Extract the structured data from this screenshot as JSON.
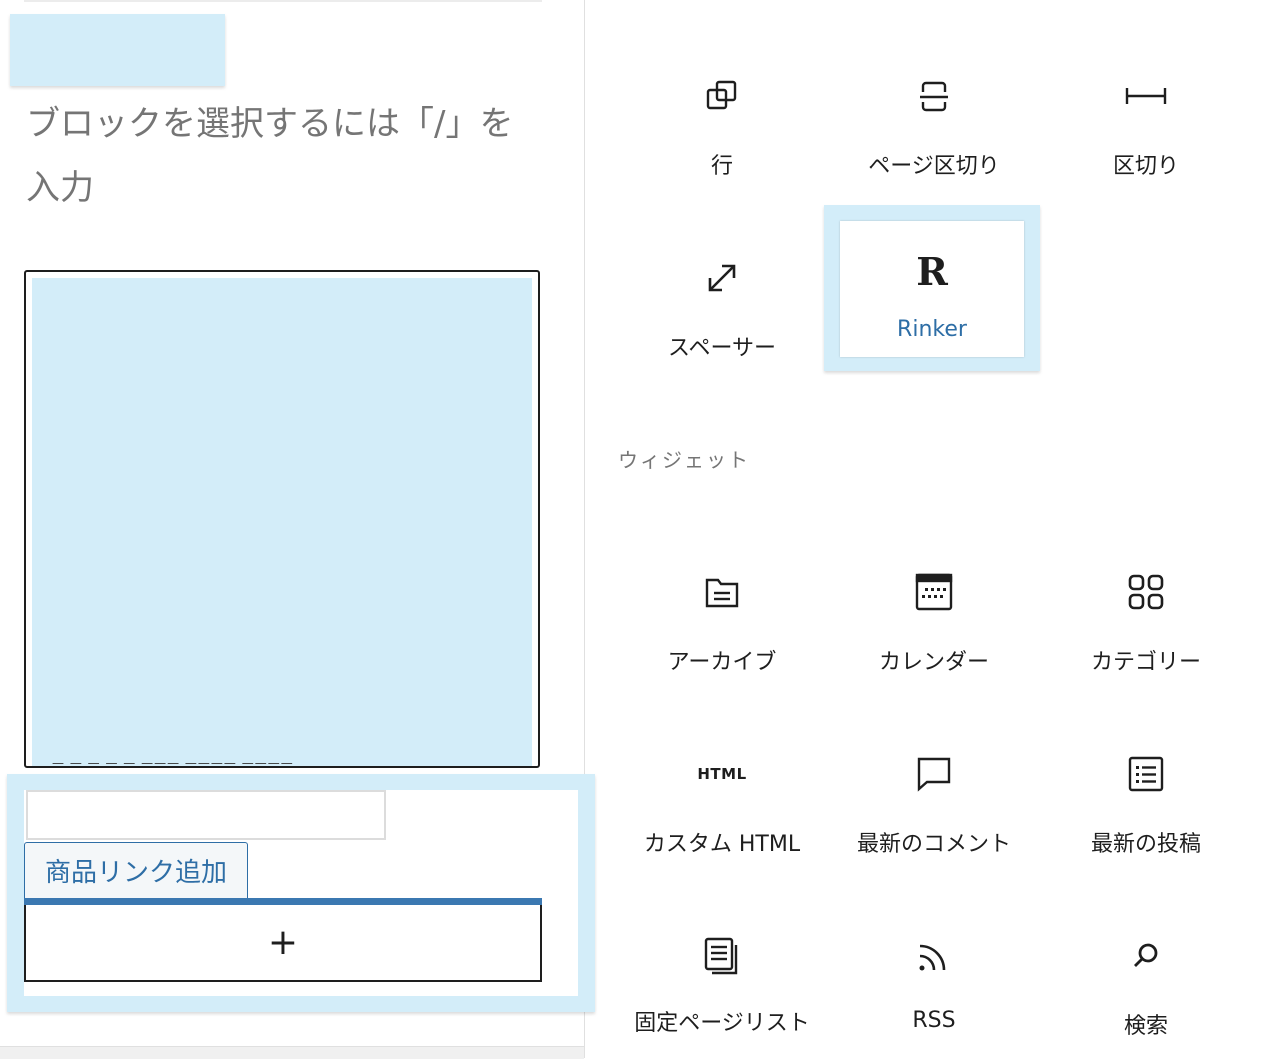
{
  "editor": {
    "placeholder": "ブロックを選択するには「/」を入力",
    "partial_text": "— — — — — ——— ———— ————",
    "rinker": {
      "add_link_tab": "商品リンク追加",
      "appender_glyph": "+"
    }
  },
  "inserter": {
    "design_blocks": [
      {
        "label": "行",
        "icon": "row-icon"
      },
      {
        "label": "ページ区切り",
        "icon": "page-break-icon"
      },
      {
        "label": "区切り",
        "icon": "separator-icon"
      },
      {
        "label": "スペーサー",
        "icon": "spacer-icon"
      }
    ],
    "rinker_block": {
      "label": "Rinker",
      "icon_glyph": "R"
    },
    "widgets_title": "ウィジェット",
    "widget_blocks": [
      {
        "label": "アーカイブ",
        "icon": "archive-icon"
      },
      {
        "label": "カレンダー",
        "icon": "calendar-icon"
      },
      {
        "label": "カテゴリー",
        "icon": "categories-icon"
      },
      {
        "label": "カスタム HTML",
        "icon": "html-icon",
        "icon_text": "HTML"
      },
      {
        "label": "最新のコメント",
        "icon": "latest-comments-icon"
      },
      {
        "label": "最新の投稿",
        "icon": "latest-posts-icon"
      },
      {
        "label": "固定ページリスト",
        "icon": "page-list-icon"
      },
      {
        "label": "RSS",
        "icon": "rss-icon"
      },
      {
        "label": "検索",
        "icon": "search-icon"
      }
    ],
    "colors": {
      "accent": "#2e6ea6",
      "highlight": "#d3edf9",
      "text": "#1e1e1e"
    }
  }
}
